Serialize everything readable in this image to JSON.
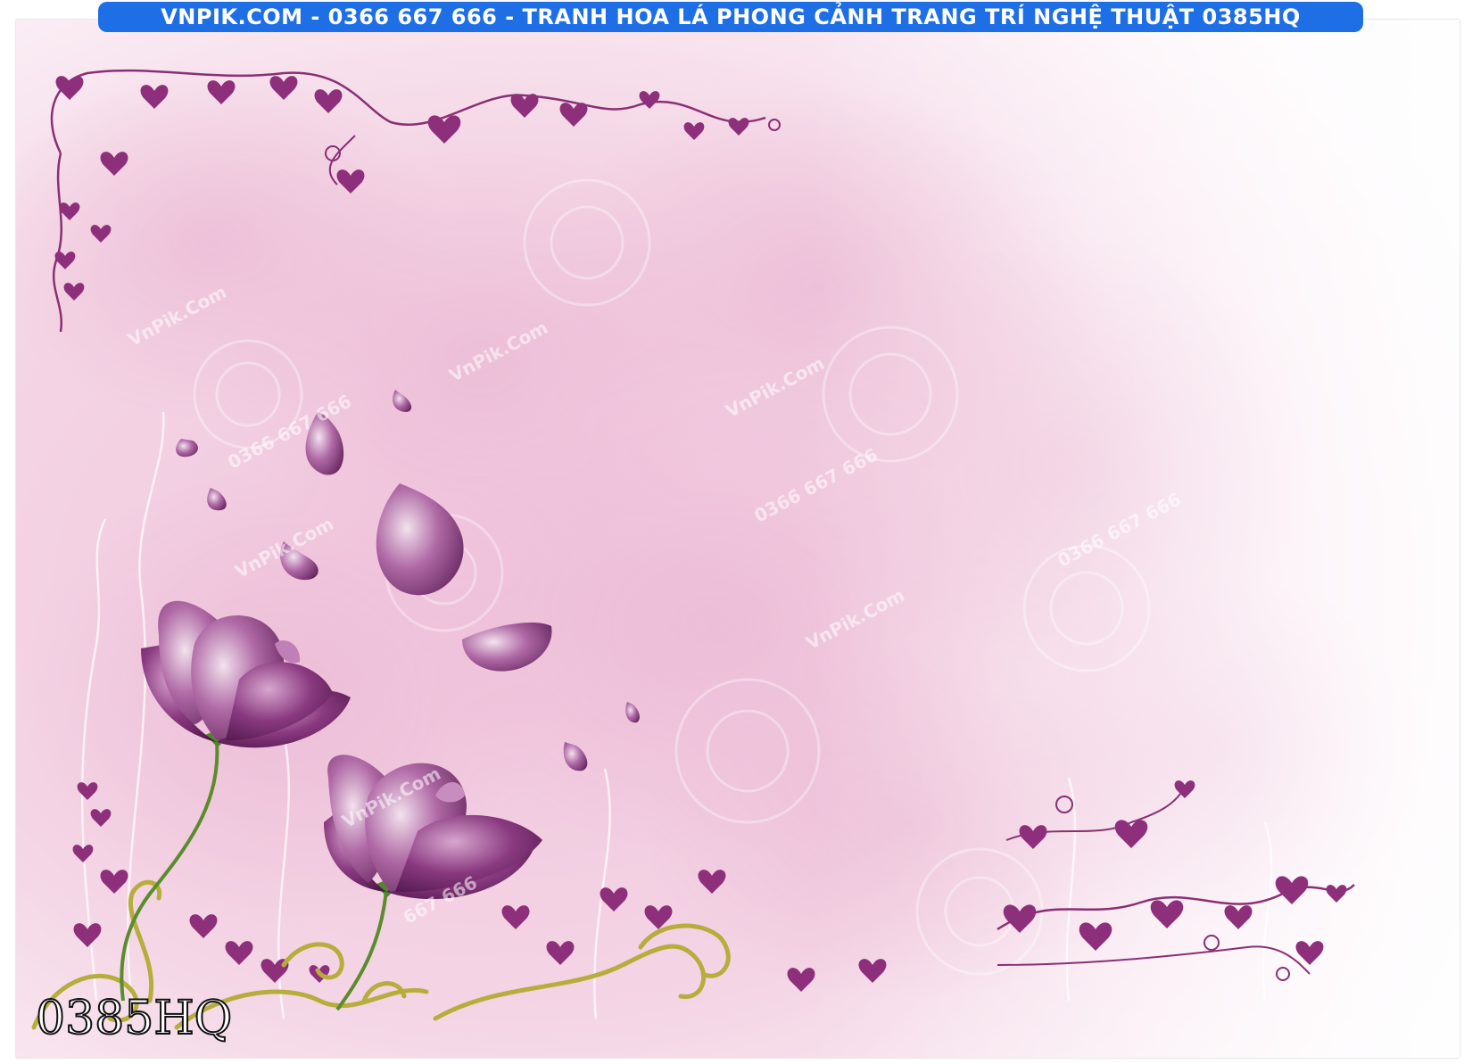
{
  "banner": {
    "text": "VNPIK.COM - 0366 667 666 - TRANH HOA LÁ PHONG CẢNH TRANG TRÍ NGHỆ THUẬT 0385HQ",
    "color": "#1e6fe6"
  },
  "product_code": "0385HQ",
  "watermarks": [
    "VnPik.Com",
    "0366 667 666",
    "667 666"
  ],
  "colors": {
    "flower": "#7a2a6e",
    "flower_light": "#c9a0c8",
    "vine": "#8a2f74",
    "stem": "#5a8c2c",
    "swirl": "#b6ad3d",
    "background": "#f3d6e6"
  }
}
